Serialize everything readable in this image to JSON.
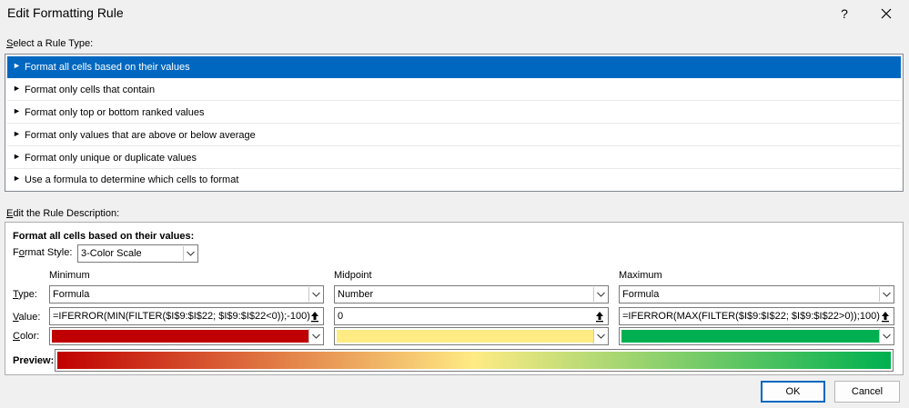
{
  "window": {
    "title": "Edit Formatting Rule",
    "help": "?"
  },
  "rule_type": {
    "heading": "Select a Rule Type:",
    "items": [
      {
        "label": "Format all cells based on their values",
        "selected": true
      },
      {
        "label": "Format only cells that contain"
      },
      {
        "label": "Format only top or bottom ranked values"
      },
      {
        "label": "Format only values that are above or below average"
      },
      {
        "label": "Format only unique or duplicate values"
      },
      {
        "label": "Use a formula to determine which cells to format"
      }
    ]
  },
  "description": {
    "heading": "Edit the Rule Description:",
    "section_title": "Format all cells based on their values:",
    "format_style_label": "Format Style:",
    "format_style_value": "3-Color Scale",
    "row_labels": {
      "type": "Type:",
      "value": "Value:",
      "color": "Color:"
    },
    "columns": {
      "minimum": {
        "header": "Minimum",
        "type": "Formula",
        "value": "=IFERROR(MIN(FILTER($I$9:$I$22; $I$9:$I$22<0));-100)",
        "color": "#c00000"
      },
      "midpoint": {
        "header": "Midpoint",
        "type": "Number",
        "value": "0",
        "color": "#ffeb84"
      },
      "maximum": {
        "header": "Maximum",
        "type": "Formula",
        "value": "=IFERROR(MAX(FILTER($I$9:$I$22; $I$9:$I$22>0));100)",
        "color": "#00b050"
      }
    },
    "preview_label": "Preview:"
  },
  "buttons": {
    "ok": "OK",
    "cancel": "Cancel"
  }
}
